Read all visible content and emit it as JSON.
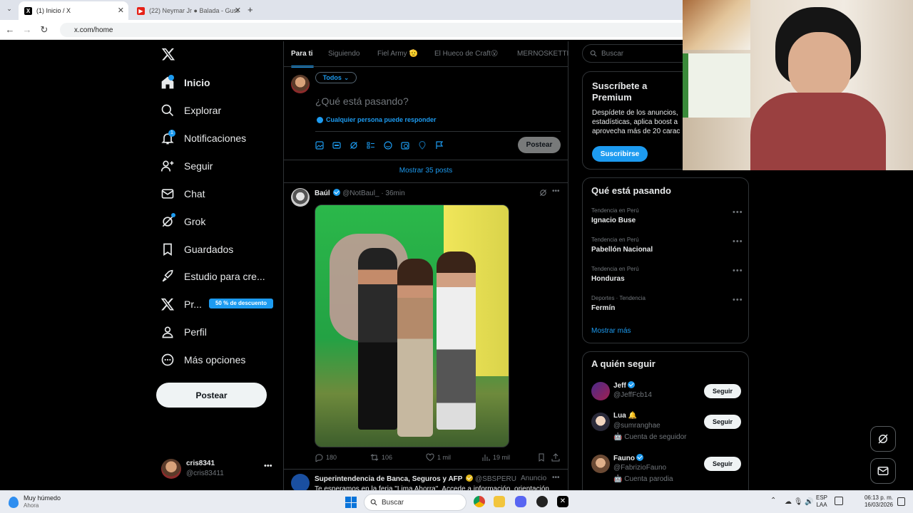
{
  "browser": {
    "tabs": [
      {
        "title": "(1) Inicio / X",
        "favicon": "X"
      },
      {
        "title": "(22) Neymar Jr ● Balada - Gust",
        "favicon": "YouTube"
      }
    ],
    "url": "x.com/home"
  },
  "sidebar": {
    "items": [
      {
        "label": "Inicio",
        "icon": "home-icon"
      },
      {
        "label": "Explorar",
        "icon": "search-icon"
      },
      {
        "label": "Notificaciones",
        "icon": "bell-icon",
        "badge": "1"
      },
      {
        "label": "Seguir",
        "icon": "person-add-icon"
      },
      {
        "label": "Chat",
        "icon": "mail-icon"
      },
      {
        "label": "Grok",
        "icon": "grok-icon"
      },
      {
        "label": "Guardados",
        "icon": "bookmark-icon"
      },
      {
        "label": "Estudio para cre...",
        "icon": "rocket-icon"
      },
      {
        "label": "Pr...",
        "icon": "x-logo-icon",
        "promo": "50 % de descuento"
      },
      {
        "label": "Perfil",
        "icon": "person-icon"
      },
      {
        "label": "Más opciones",
        "icon": "more-circle-icon"
      }
    ],
    "post_label": "Postear",
    "account": {
      "name": "cris8341",
      "handle": "@cris83411"
    }
  },
  "feed": {
    "tabs": [
      "Para ti",
      "Siguiendo",
      "Fiel Army 🫡",
      "El Hueco de Craft😮",
      "MERNOSKETTI"
    ],
    "composer": {
      "audience": "Todos",
      "placeholder": "¿Qué está pasando?",
      "reply_setting": "Cualquier persona puede responder",
      "post_label": "Postear"
    },
    "show_more": "Mostrar 35 posts",
    "post": {
      "name": "Baúl",
      "handle": "@NotBaul_",
      "time": "· 36min",
      "replies": "180",
      "reposts": "106",
      "likes": "1 mil",
      "views": "19 mil"
    },
    "next_post": {
      "name": "Superintendencia de Banca, Seguros y AFP",
      "handle": "@SBSPERU",
      "tag": "Anuncio",
      "text": "Te esperamos en la feria \"Lima Ahorra\". Accede a información, orientación"
    }
  },
  "right": {
    "search_placeholder": "Buscar",
    "premium": {
      "title": "Suscríbete a Premium",
      "text": "Despídete de los anuncios, estadísticas, aplica boost a aprovecha más de 20 carac",
      "button": "Suscribirse"
    },
    "trends_title": "Qué está pasando",
    "trends": [
      {
        "meta": "Tendencia en Perú",
        "name": "Ignacio Buse"
      },
      {
        "meta": "Tendencia en Perú",
        "name": "Pabellón Nacional"
      },
      {
        "meta": "Tendencia en Perú",
        "name": "Honduras"
      },
      {
        "meta": "Deportes · Tendencia",
        "name": "Fermín"
      }
    ],
    "show_more": "Mostrar más",
    "who_title": "A quién seguir",
    "who": [
      {
        "name": "Jeff",
        "handle": "@JeffFcb14",
        "verified": true,
        "note": ""
      },
      {
        "name": "Lua 🔔",
        "handle": "@sumranghae",
        "verified": false,
        "note": "🤖 Cuenta de seguidor"
      },
      {
        "name": "Fauno",
        "handle": "@FabrizioFauno",
        "verified": true,
        "note": "🤖 Cuenta parodia"
      }
    ],
    "follow_label": "Seguir"
  },
  "taskbar": {
    "weather": "Muy húmedo",
    "weather_sub": "Ahora",
    "search": "Buscar",
    "lang": "ESP",
    "lang2": "LAA",
    "time": "06:13 p. m.",
    "date": "16/03/2026"
  },
  "colors": {
    "accent": "#1d9bf0",
    "bg": "#000000",
    "border": "#2f3336",
    "muted": "#71767b"
  }
}
